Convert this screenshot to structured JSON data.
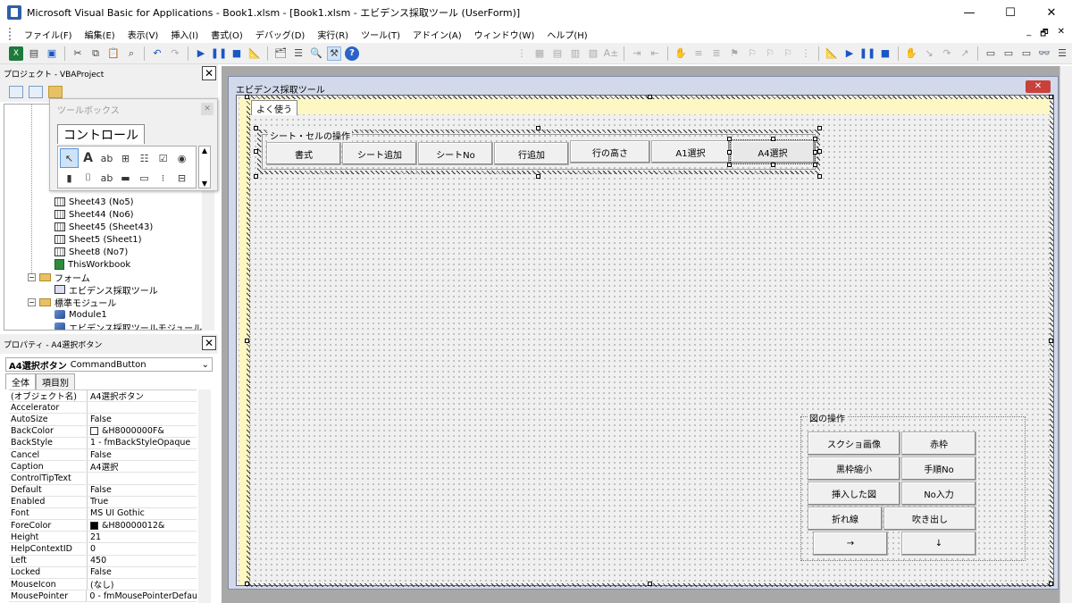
{
  "window": {
    "title": "Microsoft Visual Basic for Applications - Book1.xlsm - [Book1.xlsm - エビデンス採取ツール (UserForm)]",
    "minimize": "—",
    "maximize": "☐",
    "close": "✕"
  },
  "menu": {
    "items": [
      "ファイル(F)",
      "編集(E)",
      "表示(V)",
      "挿入(I)",
      "書式(O)",
      "デバッグ(D)",
      "実行(R)",
      "ツール(T)",
      "アドイン(A)",
      "ウィンドウ(W)",
      "ヘルプ(H)"
    ],
    "right": [
      "_",
      "🗗",
      "✕"
    ]
  },
  "project": {
    "header": "プロジェクト - VBAProject",
    "close": "✕",
    "tree": [
      {
        "label": "Sheet43 (No5)",
        "icon": "sheet-icon"
      },
      {
        "label": "Sheet44 (No6)",
        "icon": "sheet-icon"
      },
      {
        "label": "Sheet45 (Sheet43)",
        "icon": "sheet-icon"
      },
      {
        "label": "Sheet5 (Sheet1)",
        "icon": "sheet-icon"
      },
      {
        "label": "Sheet8 (No7)",
        "icon": "sheet-icon"
      },
      {
        "label": "ThisWorkbook",
        "icon": "workbook-icon"
      },
      {
        "label": "フォーム",
        "icon": "folder-icon"
      },
      {
        "label": "エビデンス採取ツール",
        "icon": "form-icon"
      },
      {
        "label": "標準モジュール",
        "icon": "folder-icon"
      },
      {
        "label": "Module1",
        "icon": "module-icon"
      },
      {
        "label": "エビデンス採取ツールモジュール",
        "icon": "module-icon"
      }
    ]
  },
  "toolbox": {
    "title": "ツールボックス",
    "tab": "コントロール"
  },
  "properties": {
    "header": "プロパティ - A4選択ボタン",
    "close": "✕",
    "object_name": "A4選択ボタン",
    "object_type": "CommandButton",
    "tabs": [
      "全体",
      "項目別"
    ],
    "rows": [
      {
        "name": "(オブジェクト名)",
        "value": "A4選択ボタン"
      },
      {
        "name": "Accelerator",
        "value": ""
      },
      {
        "name": "AutoSize",
        "value": "False"
      },
      {
        "name": "BackColor",
        "value": "&H8000000F&",
        "swatch": "#ffffff"
      },
      {
        "name": "BackStyle",
        "value": "1 - fmBackStyleOpaque"
      },
      {
        "name": "Cancel",
        "value": "False"
      },
      {
        "name": "Caption",
        "value": "A4選択"
      },
      {
        "name": "ControlTipText",
        "value": ""
      },
      {
        "name": "Default",
        "value": "False"
      },
      {
        "name": "Enabled",
        "value": "True"
      },
      {
        "name": "Font",
        "value": "MS UI Gothic"
      },
      {
        "name": "ForeColor",
        "value": "&H80000012&",
        "swatch": "#000000"
      },
      {
        "name": "Height",
        "value": "21"
      },
      {
        "name": "HelpContextID",
        "value": "0"
      },
      {
        "name": "Left",
        "value": "450"
      },
      {
        "name": "Locked",
        "value": "False"
      },
      {
        "name": "MouseIcon",
        "value": "(なし)"
      },
      {
        "name": "MousePointer",
        "value": "0 - fmMousePointerDefau"
      }
    ]
  },
  "userform": {
    "title": "エビデンス採取ツール",
    "close": "✕",
    "page_tab": "よく使う",
    "frame1_caption": "シート・セルの操作",
    "frame1_buttons": [
      "書式",
      "シート追加",
      "シートNo",
      "行追加",
      "行の高さ",
      "A1選択",
      "A4選択"
    ],
    "frame2_caption": "図の操作",
    "frame2_buttons": [
      [
        "スクショ画像",
        "赤枠"
      ],
      [
        "黒枠縮小",
        "手順No"
      ],
      [
        "挿入した図",
        "No入力"
      ],
      [
        "折れ線",
        "吹き出し"
      ],
      [
        "→",
        "↓"
      ]
    ]
  },
  "colors": {
    "titlebar": "#ffffff",
    "form_bg": "#f0f0f0",
    "strip": "#fdf7c3",
    "close_red": "#c8413a"
  }
}
